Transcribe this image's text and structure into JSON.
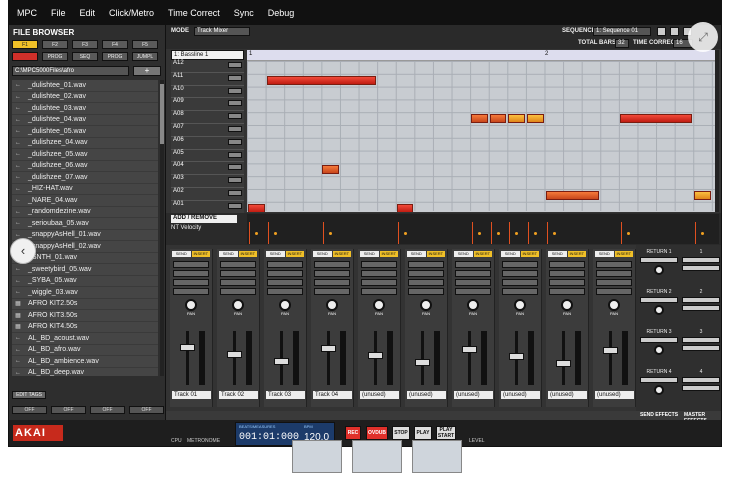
{
  "menu": [
    "MPC",
    "File",
    "Edit",
    "Click/Metro",
    "Time Correct",
    "Sync",
    "Debug"
  ],
  "file_browser": {
    "title": "FILE BROWSER",
    "path": "C:\\MPC5000Files\\afro",
    "plus": "+",
    "tab_buttons": [
      "F1",
      "F2",
      "F3",
      "F4",
      "F5"
    ],
    "tab_buttons_row2": [
      "",
      "PROG",
      "SEQ",
      "PROG",
      "JUMPL"
    ],
    "files": [
      "_dulishtee_01.wav",
      "_dulishtee_02.wav",
      "_dulishtee_03.wav",
      "_dulishtee_04.wav",
      "_dulishtee_05.wav",
      "_dulishzee_04.wav",
      "_dulishzee_05.wav",
      "_dulishzee_06.wav",
      "_dulishzee_07.wav",
      "_HIZ-HAT.wav",
      "_NARE_04.wav",
      "_randomdezine.wav",
      "_serioubaa_05.wav",
      "_snappyAsHell_01.wav",
      "_snappyAsHell_02.wav",
      "_SNTH_01.wav",
      "_sweetybird_05.wav",
      "_SYBA_05.wav",
      "_wiggle_03.wav",
      "AFRO KIT2.50s",
      "AFRO KIT3.50s",
      "AFRO KIT4.50s",
      "AL_BD_acoust.wav",
      "AL_BD_afro.wav",
      "AL_BD_ambience.wav",
      "AL_BD_deep.wav"
    ],
    "edit_tags": "EDIT TAGS",
    "off_buttons": [
      "OFF",
      "OFF",
      "OFF",
      "OFF"
    ]
  },
  "top": {
    "mode_label": "MODE",
    "mode_value": "Track Mixer",
    "sequence_label": "SEQUENCE",
    "sequence_value": "1: Sequence 01",
    "total_bars_label": "TOTAL BARS",
    "total_bars": "32",
    "time_correct_label": "TIME CORRECT",
    "time_correct": "16"
  },
  "track": {
    "name": "1: Bassline 1",
    "rows": [
      "A12",
      "A11",
      "A10",
      "A09",
      "A08",
      "A07",
      "A06",
      "A05",
      "A04",
      "A03",
      "A02",
      "A01"
    ],
    "ruler_marks": [
      "1",
      "2"
    ],
    "notes": [
      {
        "row": 1,
        "start": 1,
        "len": 6,
        "color": "red"
      },
      {
        "row": 4,
        "start": 12,
        "len": 1,
        "color": "orange"
      },
      {
        "row": 4,
        "start": 13,
        "len": 1,
        "color": "orange"
      },
      {
        "row": 4,
        "start": 14,
        "len": 1,
        "color": "yellow"
      },
      {
        "row": 4,
        "start": 15,
        "len": 1,
        "color": "yellow"
      },
      {
        "row": 4,
        "start": 20,
        "len": 4,
        "color": "red"
      },
      {
        "row": 8,
        "start": 4,
        "len": 1,
        "color": "orange"
      },
      {
        "row": 10,
        "start": 16,
        "len": 3,
        "color": "orange"
      },
      {
        "row": 10,
        "start": 24,
        "len": 1,
        "color": "yellow"
      },
      {
        "row": 11,
        "start": 0,
        "len": 1,
        "color": "red"
      },
      {
        "row": 11,
        "start": 8,
        "len": 1,
        "color": "red"
      }
    ]
  },
  "velocity": {
    "add_remove": "ADD / REMOVE",
    "label": "NT Velocity"
  },
  "mixer": {
    "send": "SEND",
    "insert": "INSERT",
    "pan": "PAN",
    "strips": [
      "Track 01",
      "Track 02",
      "Track 03",
      "Track 04",
      "(unused)",
      "(unused)",
      "(unused)",
      "(unused)",
      "(unused)",
      "(unused)"
    ],
    "returns": [
      "RETURN 1",
      "RETURN 2",
      "RETURN 3",
      "RETURN 4"
    ],
    "masters": [
      "1",
      "2",
      "3",
      "4"
    ],
    "send_effects": "SEND EFFECTS",
    "master_effects": "MASTER EFFECTS"
  },
  "transport": {
    "brand": "AKAI",
    "beats_label": "BEATS/MEASURES",
    "bpm_label": "BPM",
    "position": "001:01:000",
    "bpm": "120.0",
    "buttons": [
      "REC",
      "OVDUB",
      "STOP",
      "PLAY",
      "PLAY START"
    ],
    "cpu": "CPU",
    "metronome": "METRONOME",
    "level": "LEVEL"
  }
}
